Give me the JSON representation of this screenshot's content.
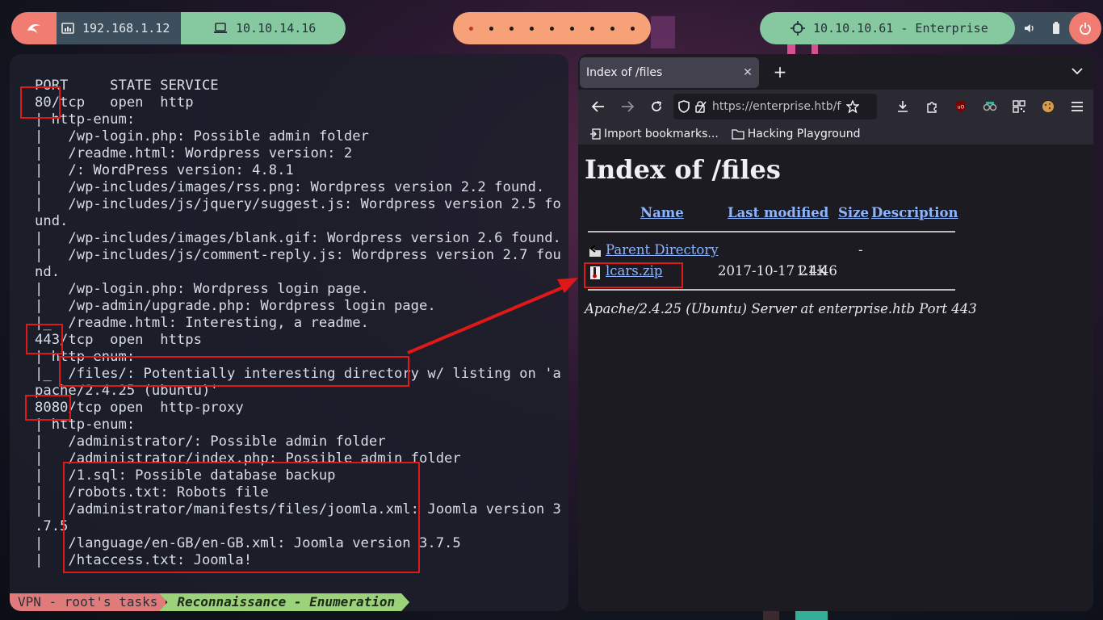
{
  "topbar": {
    "local_ip": "192.168.1.12",
    "vpn_ip": "10.10.14.16",
    "target": "10.10.10.61 - Enterprise",
    "workspaces": [
      true,
      false,
      false,
      false,
      false,
      false,
      false,
      false,
      false
    ]
  },
  "terminal": {
    "lines": [
      "PORT     STATE SERVICE",
      "80/tcp   open  http",
      "| http-enum:",
      "|   /wp-login.php: Possible admin folder",
      "|   /readme.html: Wordpress version: 2",
      "|   /: WordPress version: 4.8.1",
      "|   /wp-includes/images/rss.png: Wordpress version 2.2 found.",
      "|   /wp-includes/js/jquery/suggest.js: Wordpress version 2.5 fo",
      "und.",
      "|   /wp-includes/images/blank.gif: Wordpress version 2.6 found.",
      "|   /wp-includes/js/comment-reply.js: Wordpress version 2.7 fou",
      "nd.",
      "|   /wp-login.php: Wordpress login page.",
      "|   /wp-admin/upgrade.php: Wordpress login page.",
      "|_  /readme.html: Interesting, a readme.",
      "443/tcp  open  https",
      "| http-enum:",
      "|_  /files/: Potentially interesting directory w/ listing on 'a",
      "pache/2.4.25 (ubuntu)'",
      "8080/tcp open  http-proxy",
      "| http-enum:",
      "|   /administrator/: Possible admin folder",
      "|   /administrator/index.php: Possible admin folder",
      "|   /1.sql: Possible database backup",
      "|   /robots.txt: Robots file",
      "|   /administrator/manifests/files/joomla.xml: Joomla version 3",
      ".7.5",
      "|   /language/en-GB/en-GB.xml: Joomla version 3.7.5",
      "|   /htaccess.txt: Joomla!"
    ],
    "status_session": "VPN - root's tasks",
    "status_task": "Reconnaissance - Enumeration"
  },
  "browser": {
    "tab_title": "Index of /files",
    "url": "https://enterprise.htb/files/",
    "bookmarks": [
      "Import bookmarks...",
      "Hacking Playground"
    ],
    "page": {
      "heading": "Index of /files",
      "columns": [
        "Name",
        "Last modified",
        "Size",
        "Description"
      ],
      "rows": [
        {
          "name": "Parent Directory",
          "modified": "",
          "size": "-"
        },
        {
          "name": "lcars.zip",
          "modified": "2017-10-17 21:46",
          "size": "1.4K"
        }
      ],
      "address": "Apache/2.4.25 (Ubuntu) Server at enterprise.htb Port 443"
    }
  },
  "colors": {
    "annotation_red": "#e01818",
    "link_blue": "#8cb4ff",
    "accent_green": "#86c9a0",
    "accent_salmon": "#f07c72",
    "accent_orange": "#f7a178"
  }
}
